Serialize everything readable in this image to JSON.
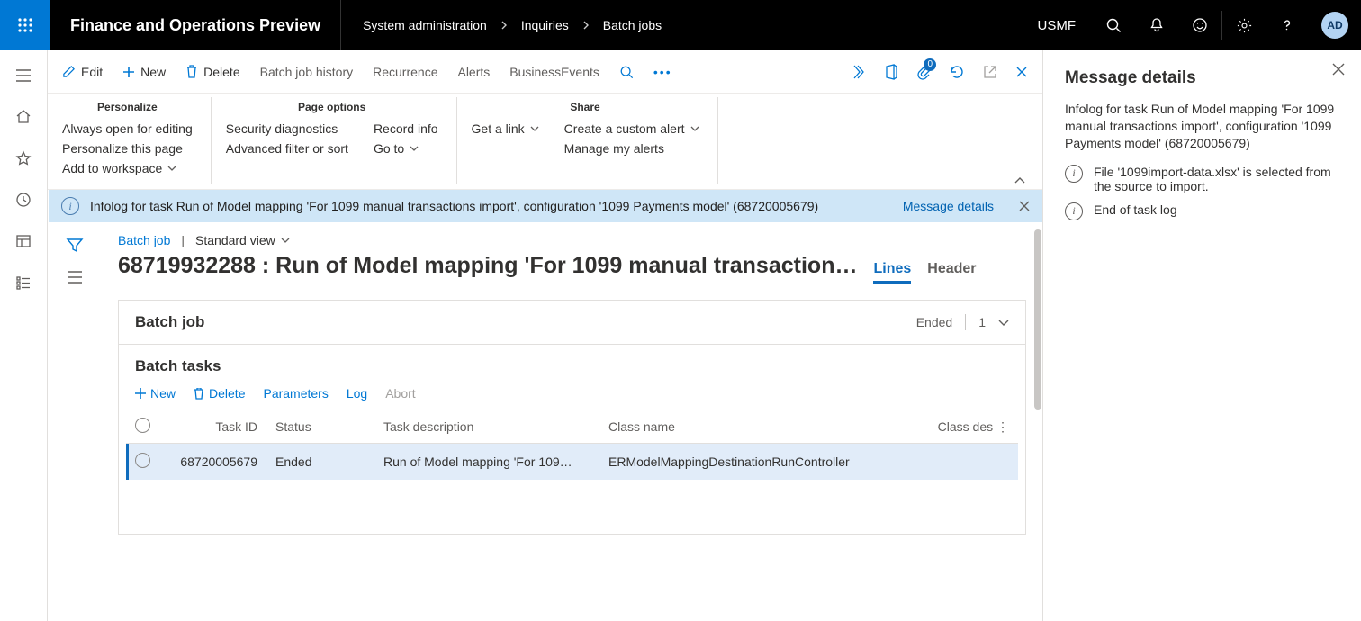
{
  "top": {
    "app_title": "Finance and Operations Preview",
    "crumbs": [
      "System administration",
      "Inquiries",
      "Batch jobs"
    ],
    "company": "USMF",
    "avatar": "AD"
  },
  "ab": {
    "edit": "Edit",
    "new": "New",
    "delete": "Delete",
    "history": "Batch job history",
    "recurrence": "Recurrence",
    "alerts": "Alerts",
    "be": "BusinessEvents",
    "attach_count": "0"
  },
  "ribbon": {
    "g1": {
      "title": "Personalize",
      "items": [
        "Always open for editing",
        "Personalize this page",
        "Add to workspace"
      ]
    },
    "g2": {
      "title": "Page options",
      "colA": [
        "Security diagnostics",
        "Advanced filter or sort"
      ],
      "colB": [
        "Record info",
        "Go to"
      ]
    },
    "g3": {
      "title": "Share",
      "colA": [
        "Get a link"
      ],
      "colB": [
        "Create a custom alert",
        "Manage my alerts"
      ]
    }
  },
  "infobar": {
    "text": "Infolog for task Run of Model mapping 'For 1099 manual transactions import', configuration '1099 Payments model' (68720005679)",
    "link": "Message details"
  },
  "page": {
    "crumb_batchjob": "Batch job",
    "view": "Standard view",
    "title": "68719932288 : Run of Model mapping 'For 1099 manual transaction…",
    "tabs": {
      "lines": "Lines",
      "header": "Header"
    }
  },
  "card": {
    "title": "Batch job",
    "status": "Ended",
    "count": "1",
    "tasks_title": "Batch tasks"
  },
  "tasktb": {
    "new": "New",
    "delete": "Delete",
    "params": "Parameters",
    "log": "Log",
    "abort": "Abort"
  },
  "cols": {
    "taskid": "Task ID",
    "status": "Status",
    "desc": "Task description",
    "class": "Class name",
    "classdesc": "Class des"
  },
  "row": {
    "taskid": "68720005679",
    "status": "Ended",
    "desc": "Run of Model mapping 'For 109…",
    "class": "ERModelMappingDestinationRunController"
  },
  "details": {
    "title": "Message details",
    "desc": "Infolog for task Run of Model mapping 'For 1099 manual transactions import', configuration '1099 Payments model' (68720005679)",
    "m1": "File '1099import-data.xlsx' is selected from the source to import.",
    "m2": "End of task log"
  }
}
